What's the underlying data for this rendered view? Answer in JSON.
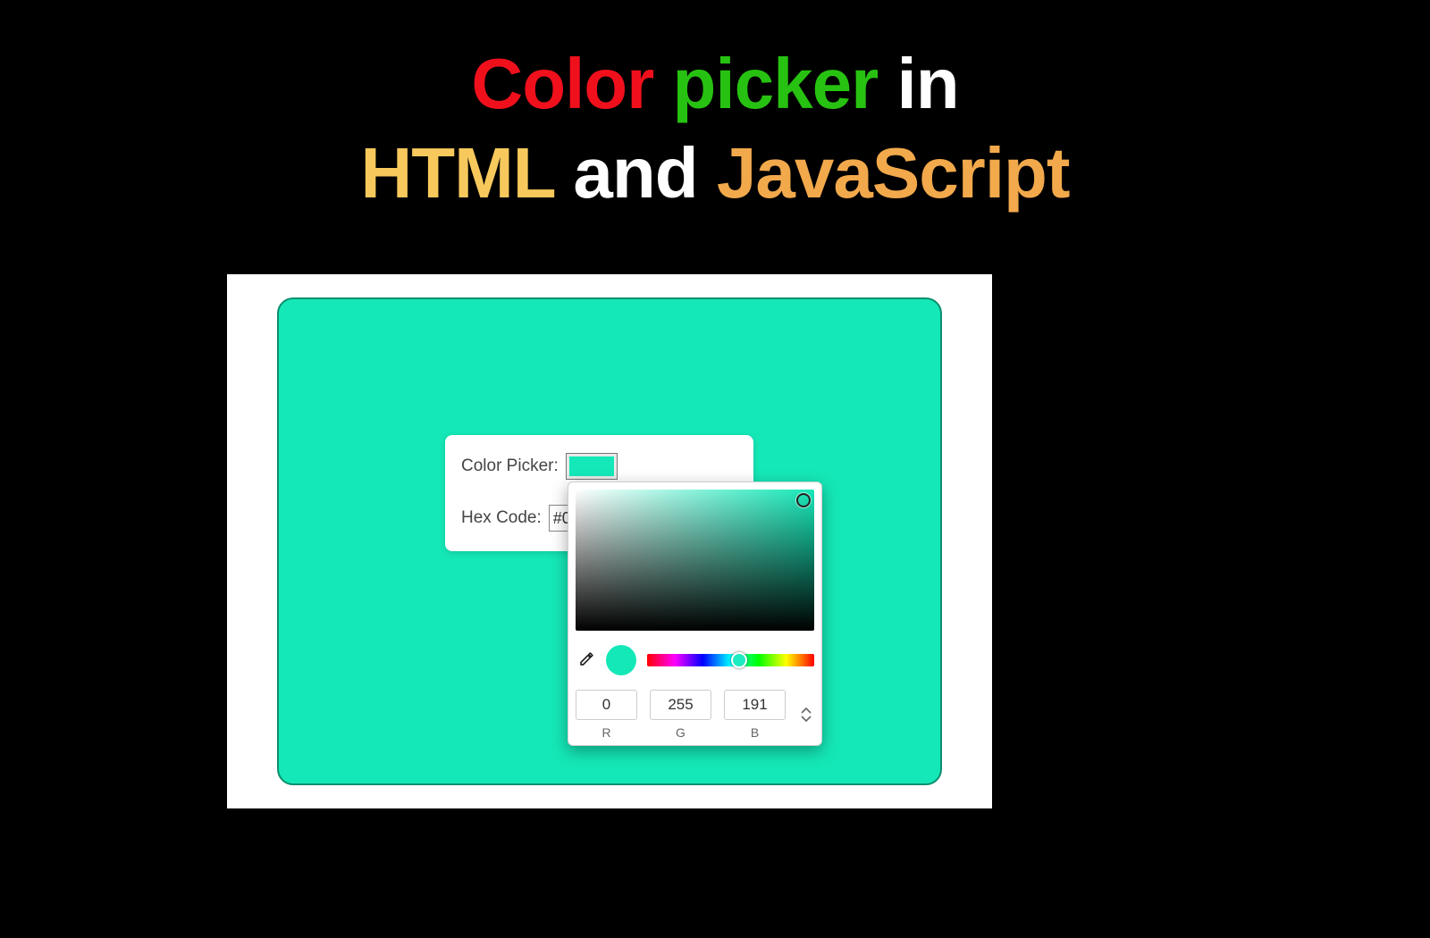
{
  "title": {
    "w1": "Color",
    "w2": "picker",
    "w3": "in",
    "w4": "HTML",
    "w5": "and",
    "w6": "JavaScript"
  },
  "form": {
    "color_picker_label": "Color Picker:",
    "hex_label": "Hex Code:",
    "hex_value": "#0"
  },
  "picker": {
    "rgb": {
      "r": "0",
      "g": "255",
      "b": "191"
    },
    "labels": {
      "r": "R",
      "g": "G",
      "b": "B"
    }
  },
  "colors": {
    "selected": "#15e8b8",
    "canvas": "#15e8b8",
    "hue_thumb_bg": "#1febc0",
    "hue_thumb_left_pct": 55
  }
}
